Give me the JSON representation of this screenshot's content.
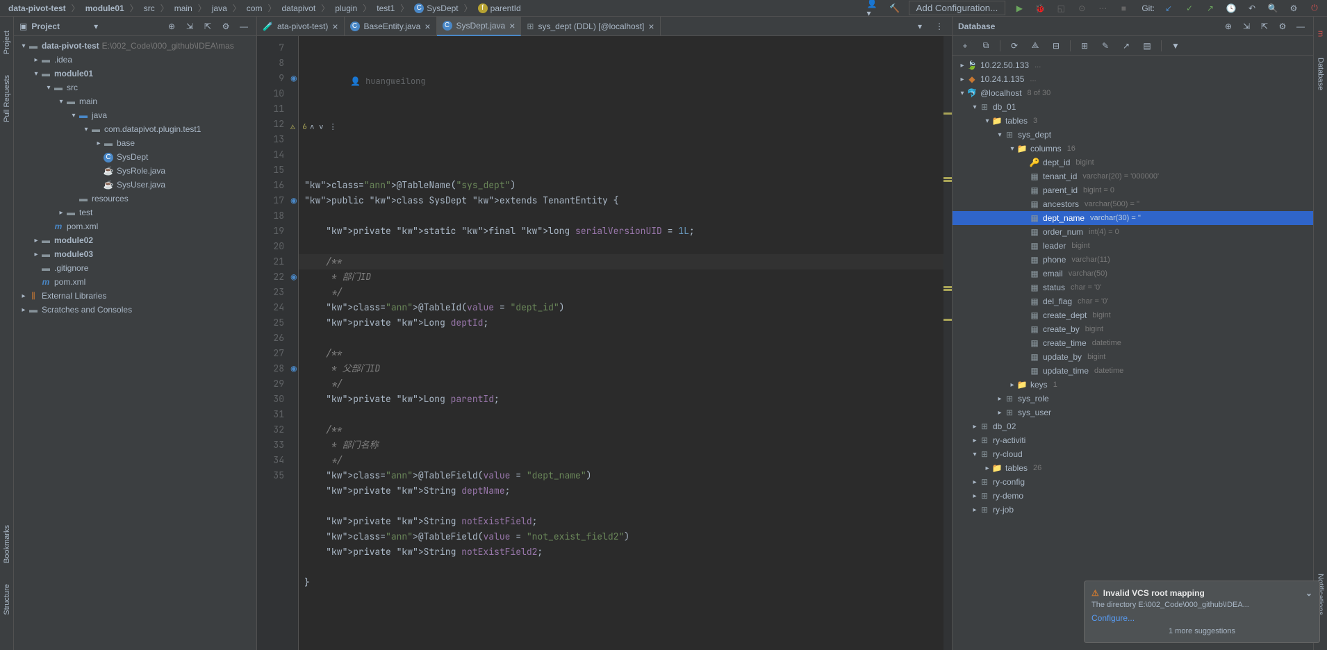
{
  "breadcrumbs": [
    "data-pivot-test",
    "module01",
    "src",
    "main",
    "java",
    "com",
    "datapivot",
    "plugin",
    "test1",
    "SysDept",
    "parentId"
  ],
  "breadcrumb_icons": {
    "9": "C",
    "10": "f"
  },
  "toolbar": {
    "add_config": "Add Configuration...",
    "git_label": "Git:"
  },
  "project_panel": {
    "title": "Project",
    "tree": [
      {
        "indent": 0,
        "arrow": "▾",
        "icon": "📁",
        "label": "data-pivot-test",
        "bold": true,
        "hint": "E:\\002_Code\\000_github\\IDEA\\mas"
      },
      {
        "indent": 1,
        "arrow": "▸",
        "icon": "📁",
        "label": ".idea"
      },
      {
        "indent": 1,
        "arrow": "▾",
        "icon": "📁",
        "label": "module01",
        "bold": true
      },
      {
        "indent": 2,
        "arrow": "▾",
        "icon": "📁",
        "label": "src"
      },
      {
        "indent": 3,
        "arrow": "▾",
        "icon": "📁",
        "label": "main"
      },
      {
        "indent": 4,
        "arrow": "▾",
        "icon": "📁",
        "label": "java",
        "blue": true
      },
      {
        "indent": 5,
        "arrow": "▾",
        "icon": "📁",
        "label": "com.datapivot.plugin.test1"
      },
      {
        "indent": 6,
        "arrow": "▸",
        "icon": "📁",
        "label": "base"
      },
      {
        "indent": 6,
        "arrow": "",
        "icon": "C",
        "label": "SysDept"
      },
      {
        "indent": 6,
        "arrow": "",
        "icon": "J",
        "label": "SysRole.java"
      },
      {
        "indent": 6,
        "arrow": "",
        "icon": "J",
        "label": "SysUser.java"
      },
      {
        "indent": 4,
        "arrow": "",
        "icon": "📁",
        "label": "resources"
      },
      {
        "indent": 3,
        "arrow": "▸",
        "icon": "📁",
        "label": "test"
      },
      {
        "indent": 2,
        "arrow": "",
        "icon": "m",
        "label": "pom.xml"
      },
      {
        "indent": 1,
        "arrow": "▸",
        "icon": "📁",
        "label": "module02",
        "bold": true
      },
      {
        "indent": 1,
        "arrow": "▸",
        "icon": "📁",
        "label": "module03",
        "bold": true
      },
      {
        "indent": 1,
        "arrow": "",
        "icon": "◻",
        "label": ".gitignore"
      },
      {
        "indent": 1,
        "arrow": "",
        "icon": "m",
        "label": "pom.xml"
      },
      {
        "indent": 0,
        "arrow": "▸",
        "icon": "📚",
        "label": "External Libraries"
      },
      {
        "indent": 0,
        "arrow": "▸",
        "icon": "📁",
        "label": "Scratches and Consoles"
      }
    ]
  },
  "editor_tabs": [
    {
      "label": "ata-pivot-test)",
      "icon": "🧪",
      "active": false
    },
    {
      "label": "BaseEntity.java",
      "icon": "C",
      "active": false
    },
    {
      "label": "SysDept.java",
      "icon": "C",
      "active": true
    },
    {
      "label": "sys_dept (DDL) [@localhost]",
      "icon": "⊞",
      "active": false
    }
  ],
  "editor": {
    "author": "huangweilong",
    "inspection_count": "6",
    "lines_start": 7,
    "lines_end": 35,
    "code": [
      "",
      "@TableName(\"sys_dept\")",
      "public class SysDept extends TenantEntity {",
      "",
      "    private static final long serialVersionUID = 1L;",
      "",
      "    /**",
      "     * 部门ID",
      "     */",
      "    @TableId(value = \"dept_id\")",
      "    private Long deptId;",
      "",
      "    /**",
      "     * 父部门ID",
      "     */",
      "    private Long parentId;",
      "",
      "    /**",
      "     * 部门名称",
      "     */",
      "    @TableField(value = \"dept_name\")",
      "    private String deptName;",
      "",
      "    private String notExistField;",
      "    @TableField(value = \"not_exist_field2\")",
      "    private String notExistField2;",
      "",
      "}",
      ""
    ],
    "gutter_markers": {
      "9": "◉",
      "17": "◉",
      "22": "◉",
      "28": "◉"
    },
    "bulb_line": 21,
    "current_line": 21
  },
  "database_panel": {
    "title": "Database",
    "tree": [
      {
        "indent": 0,
        "arrow": "▸",
        "icon": "🍃",
        "label": "10.22.50.133",
        "hint": "..."
      },
      {
        "indent": 0,
        "arrow": "▸",
        "icon": "🔶",
        "label": "10.24.1.135",
        "hint": "..."
      },
      {
        "indent": 0,
        "arrow": "▾",
        "icon": "🐬",
        "label": "@localhost",
        "hint": "8 of 30"
      },
      {
        "indent": 1,
        "arrow": "▾",
        "icon": "⊞",
        "label": "db_01"
      },
      {
        "indent": 2,
        "arrow": "▾",
        "icon": "📁",
        "label": "tables",
        "hint": "3"
      },
      {
        "indent": 3,
        "arrow": "▾",
        "icon": "⊞",
        "label": "sys_dept"
      },
      {
        "indent": 4,
        "arrow": "▾",
        "icon": "📁",
        "label": "columns",
        "hint": "16"
      },
      {
        "indent": 5,
        "arrow": "",
        "icon": "🔑",
        "label": "dept_id",
        "meta": "bigint"
      },
      {
        "indent": 5,
        "arrow": "",
        "icon": "▦",
        "label": "tenant_id",
        "meta": "varchar(20) = '000000'"
      },
      {
        "indent": 5,
        "arrow": "",
        "icon": "▦",
        "label": "parent_id",
        "meta": "bigint = 0"
      },
      {
        "indent": 5,
        "arrow": "",
        "icon": "▦",
        "label": "ancestors",
        "meta": "varchar(500) = ''"
      },
      {
        "indent": 5,
        "arrow": "",
        "icon": "▦",
        "label": "dept_name",
        "meta": "varchar(30) = ''",
        "selected": true
      },
      {
        "indent": 5,
        "arrow": "",
        "icon": "▦",
        "label": "order_num",
        "meta": "int(4) = 0"
      },
      {
        "indent": 5,
        "arrow": "",
        "icon": "▦",
        "label": "leader",
        "meta": "bigint"
      },
      {
        "indent": 5,
        "arrow": "",
        "icon": "▦",
        "label": "phone",
        "meta": "varchar(11)"
      },
      {
        "indent": 5,
        "arrow": "",
        "icon": "▦",
        "label": "email",
        "meta": "varchar(50)"
      },
      {
        "indent": 5,
        "arrow": "",
        "icon": "▦",
        "label": "status",
        "meta": "char = '0'"
      },
      {
        "indent": 5,
        "arrow": "",
        "icon": "▦",
        "label": "del_flag",
        "meta": "char = '0'"
      },
      {
        "indent": 5,
        "arrow": "",
        "icon": "▦",
        "label": "create_dept",
        "meta": "bigint"
      },
      {
        "indent": 5,
        "arrow": "",
        "icon": "▦",
        "label": "create_by",
        "meta": "bigint"
      },
      {
        "indent": 5,
        "arrow": "",
        "icon": "▦",
        "label": "create_time",
        "meta": "datetime"
      },
      {
        "indent": 5,
        "arrow": "",
        "icon": "▦",
        "label": "update_by",
        "meta": "bigint"
      },
      {
        "indent": 5,
        "arrow": "",
        "icon": "▦",
        "label": "update_time",
        "meta": "datetime"
      },
      {
        "indent": 4,
        "arrow": "▸",
        "icon": "📁",
        "label": "keys",
        "hint": "1"
      },
      {
        "indent": 3,
        "arrow": "▸",
        "icon": "⊞",
        "label": "sys_role"
      },
      {
        "indent": 3,
        "arrow": "▸",
        "icon": "⊞",
        "label": "sys_user"
      },
      {
        "indent": 1,
        "arrow": "▸",
        "icon": "⊞",
        "label": "db_02"
      },
      {
        "indent": 1,
        "arrow": "▸",
        "icon": "⊞",
        "label": "ry-activiti"
      },
      {
        "indent": 1,
        "arrow": "▾",
        "icon": "⊞",
        "label": "ry-cloud"
      },
      {
        "indent": 2,
        "arrow": "▸",
        "icon": "📁",
        "label": "tables",
        "hint": "26"
      },
      {
        "indent": 1,
        "arrow": "▸",
        "icon": "⊞",
        "label": "ry-config"
      },
      {
        "indent": 1,
        "arrow": "▸",
        "icon": "⊞",
        "label": "ry-demo"
      },
      {
        "indent": 1,
        "arrow": "▸",
        "icon": "⊞",
        "label": "ry-job"
      }
    ]
  },
  "notification": {
    "title": "Invalid VCS root mapping",
    "body": "The directory E:\\002_Code\\000_github\\IDEA...",
    "link": "Configure...",
    "more": "1 more suggestions"
  },
  "right_sidebar": [
    "Maven",
    "Database",
    "Notifications"
  ],
  "left_sidebar": [
    "Project",
    "Pull Requests",
    "Bookmarks",
    "Structure"
  ]
}
